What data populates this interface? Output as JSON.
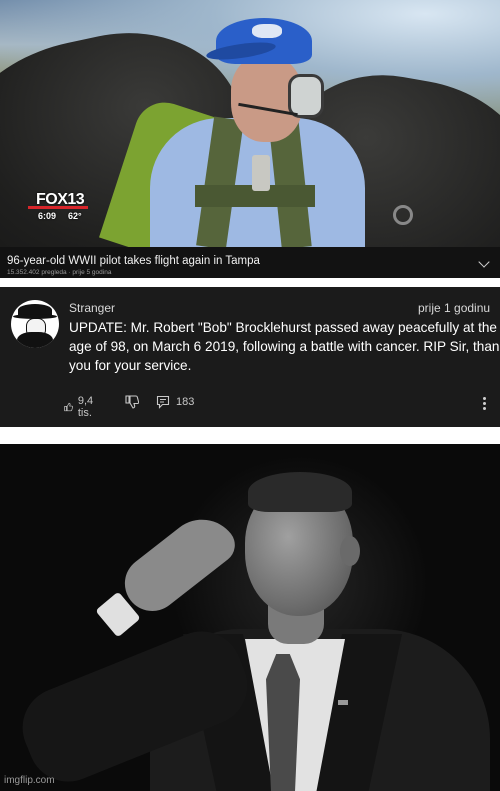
{
  "video": {
    "channel_logo": "FOX13",
    "time": "6:09",
    "temperature": "62°",
    "title": "96-year-old WWII pilot takes flight again in Tampa",
    "meta": "15.352.402 pregleda · prije 5 godina",
    "expand_icon": "chevron-down-icon"
  },
  "comment": {
    "author": "Stranger",
    "time_ago": "prije 1 godinu",
    "text": "UPDATE: Mr. Robert \"Bob\" Brocklehurst passed away peacefully at the age of 98, on March 6 2019, following a battle with cancer. RIP Sir, thank you for your service.",
    "likes": "9,4 tis.",
    "replies": "183",
    "icons": [
      "thumbs-up-icon",
      "thumbs-down-icon",
      "reply-icon",
      "more-vertical-icon"
    ]
  },
  "watermark": "imgflip.com",
  "colors": {
    "title_bar_bg": "#121212",
    "comment_bg": "#1b1b1b",
    "brand_red": "#d7262b",
    "cap_blue": "#2a5fc9"
  }
}
